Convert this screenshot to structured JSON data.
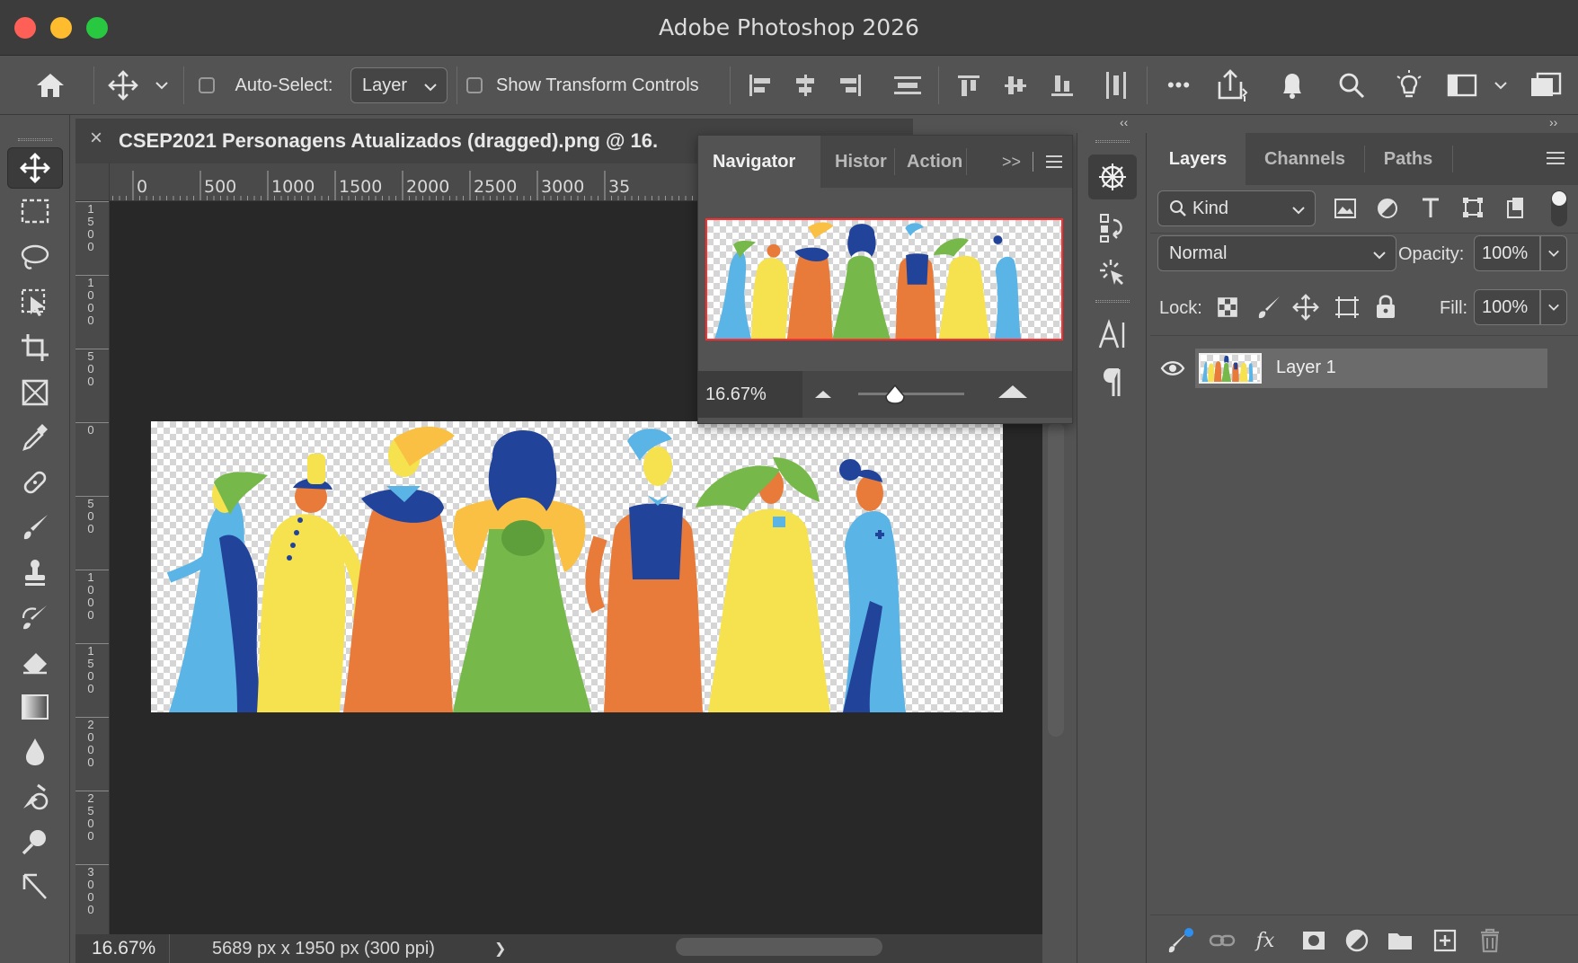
{
  "window": {
    "title": "Adobe Photoshop 2026"
  },
  "options_bar": {
    "auto_select_label": "Auto-Select:",
    "auto_select_value": "Layer",
    "show_transform_label": "Show Transform Controls",
    "more_label": "•••"
  },
  "document": {
    "title": "CSEP2021 Personagens Atualizados (dragged).png @ 16.",
    "close_label": "×",
    "ruler_h": [
      "0",
      "500",
      "1000",
      "1500",
      "2000",
      "2500",
      "3000",
      "35"
    ],
    "ruler_v": [
      [
        "1",
        "5",
        "0",
        "0"
      ],
      [
        "1",
        "0",
        "0",
        "0"
      ],
      [
        "5",
        "0",
        "0"
      ],
      [
        "0"
      ],
      [
        "5",
        "0",
        "0"
      ],
      [
        "1",
        "0",
        "0",
        "0"
      ],
      [
        "1",
        "5",
        "0",
        "0"
      ],
      [
        "2",
        "0",
        "0",
        "0"
      ],
      [
        "2",
        "5",
        "0",
        "0"
      ],
      [
        "3",
        "0",
        "0",
        "0"
      ]
    ]
  },
  "status_bar": {
    "zoom": "16.67%",
    "info": "5689 px x 1950 px (300 ppi)",
    "arrow": "❯"
  },
  "navigator": {
    "tabs": [
      "Navigator",
      "Histor",
      "Action"
    ],
    "expand_label": ">>",
    "zoom": "16.67%",
    "zoom_fraction": 0.35
  },
  "layers_panel": {
    "tabs": [
      "Layers",
      "Channels",
      "Paths"
    ],
    "filter_label": "Kind",
    "blend_mode": "Normal",
    "opacity_label": "Opacity:",
    "opacity_value": "100%",
    "lock_label": "Lock:",
    "fill_label": "Fill:",
    "fill_value": "100%",
    "layers": [
      {
        "name": "Layer 1",
        "visible": true
      }
    ],
    "footer_fx": "fx"
  },
  "panel_collapse": {
    "left": "››",
    "mid": "‹‹",
    "right": "››"
  },
  "colors": {
    "accent_red": "#ff2d2d",
    "figure_blue": "#5bb4e6",
    "figure_navy": "#21439a",
    "figure_yellow": "#f5e24e",
    "figure_orange": "#e87a3a",
    "figure_green": "#76b84a"
  }
}
